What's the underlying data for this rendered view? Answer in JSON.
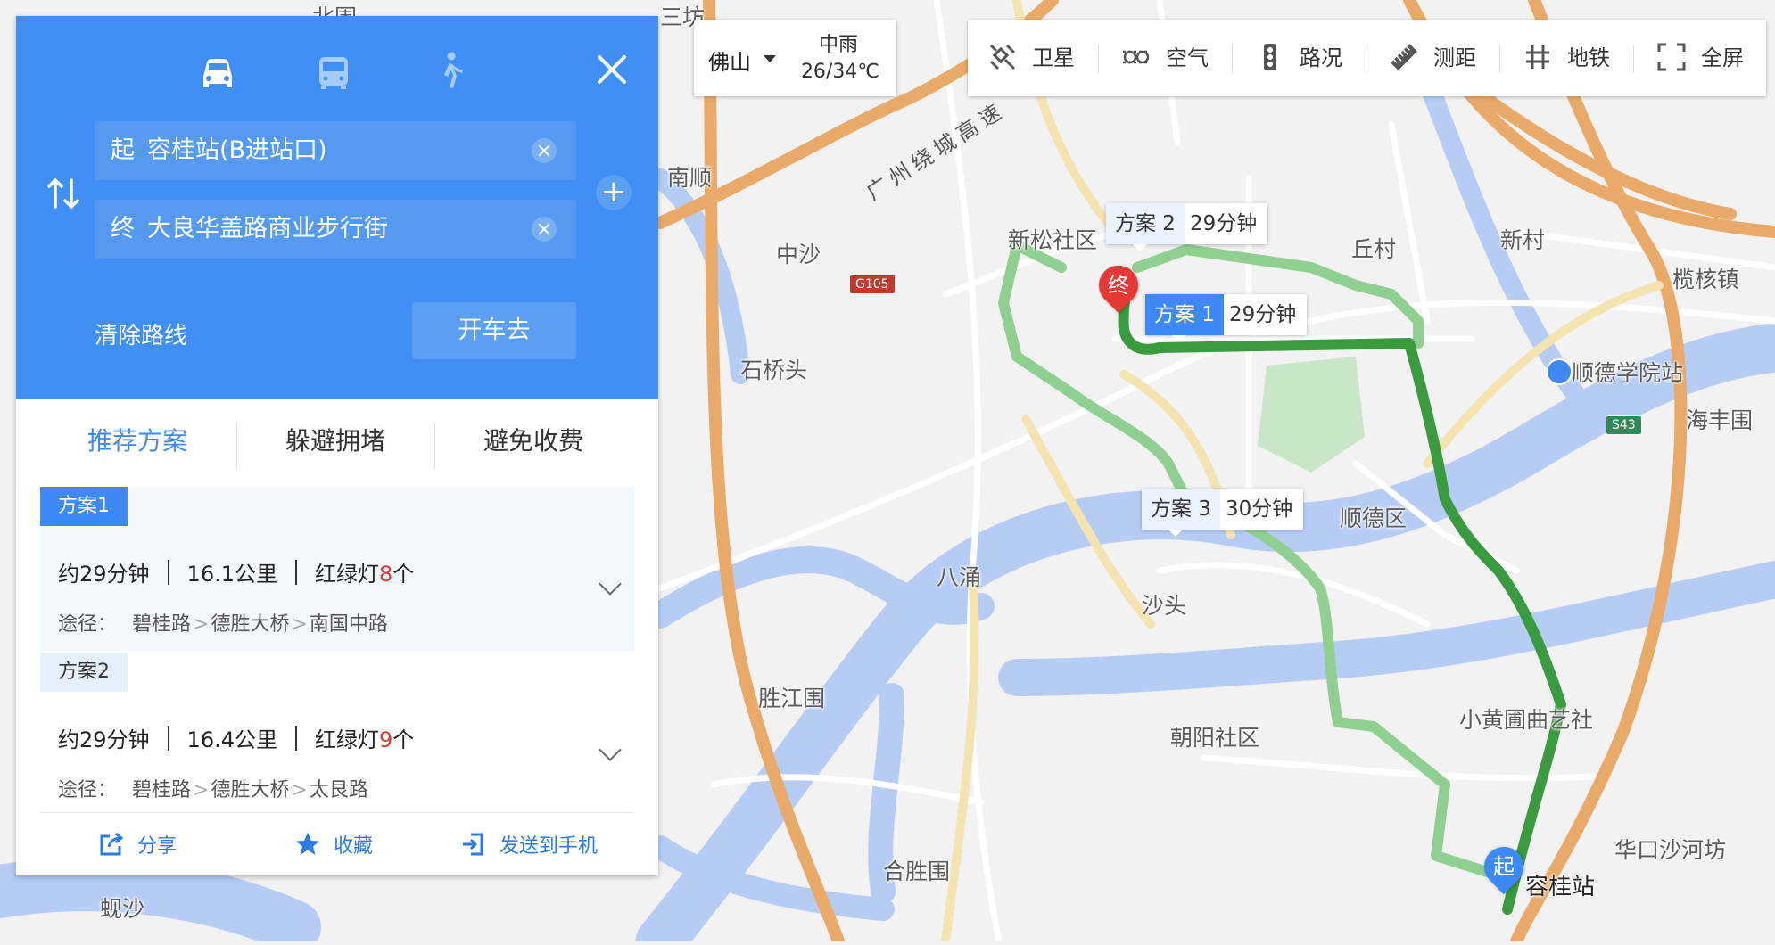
{
  "panel": {
    "modes": [
      {
        "name": "drive",
        "icon": "car-icon",
        "active": true
      },
      {
        "name": "transit",
        "icon": "bus-icon",
        "active": false
      },
      {
        "name": "walk",
        "icon": "walk-icon",
        "active": false
      }
    ],
    "start_prefix": "起",
    "start_value": "容桂站(B进站口)",
    "end_prefix": "终",
    "end_value": "大良华盖路商业步行街",
    "clear_route": "清除路线",
    "go_button": "开车去",
    "tabs": [
      "推荐方案",
      "躲避拥堵",
      "避免收费"
    ],
    "plans": [
      {
        "badge": "方案1",
        "time": "约29分钟",
        "distance": "16.1公里",
        "lights_prefix": "红绿灯",
        "lights_count": "8",
        "lights_suffix": "个",
        "via_label": "途径：",
        "via": [
          "碧桂路",
          "德胜大桥",
          "南国中路"
        ]
      },
      {
        "badge": "方案2",
        "time": "约29分钟",
        "distance": "16.4公里",
        "lights_prefix": "红绿灯",
        "lights_count": "9",
        "lights_suffix": "个",
        "via_label": "途径：",
        "via": [
          "碧桂路",
          "德胜大桥",
          "太艮路"
        ]
      }
    ],
    "footer": {
      "share": "分享",
      "favorite": "收藏",
      "send": "发送到手机"
    }
  },
  "weather": {
    "city": "佛山",
    "condition": "中雨",
    "temp": "26/34℃"
  },
  "toolbar": [
    {
      "label": "卫星",
      "icon": "satellite-icon"
    },
    {
      "label": "空气",
      "icon": "air-icon"
    },
    {
      "label": "路况",
      "icon": "traffic-light-icon"
    },
    {
      "label": "测距",
      "icon": "ruler-icon"
    },
    {
      "label": "地铁",
      "icon": "subway-icon"
    },
    {
      "label": "全屏",
      "icon": "fullscreen-icon"
    }
  ],
  "callouts": [
    {
      "name": "方案 2",
      "duration": "29分钟"
    },
    {
      "name": "方案 1",
      "duration": "29分钟"
    },
    {
      "name": "方案 3",
      "duration": "30分钟"
    }
  ],
  "markers": {
    "start": "起",
    "end": "终",
    "start_label": "容桂站"
  },
  "map_labels": [
    "北围",
    "三坊",
    "南顺",
    "中沙",
    "新松社区",
    "丘村",
    "新村",
    "榄核镇",
    "石桥头",
    "顺德学院站",
    "海丰围",
    "顺德区",
    "八涌",
    "沙头",
    "胜江围",
    "朝阳社区",
    "小黄圃曲艺社",
    "合胜围",
    "华口沙河坊",
    "蚬沙",
    "广州绕城高速"
  ],
  "road_shields": [
    "G105",
    "S43"
  ],
  "colors": {
    "primary": "#3f8ff5",
    "route_selected": "#3a9a3e",
    "route_alt": "#8fcf8f",
    "river": "#b5cdf5",
    "major_road": "#e9a968",
    "danger": "#e53935"
  }
}
